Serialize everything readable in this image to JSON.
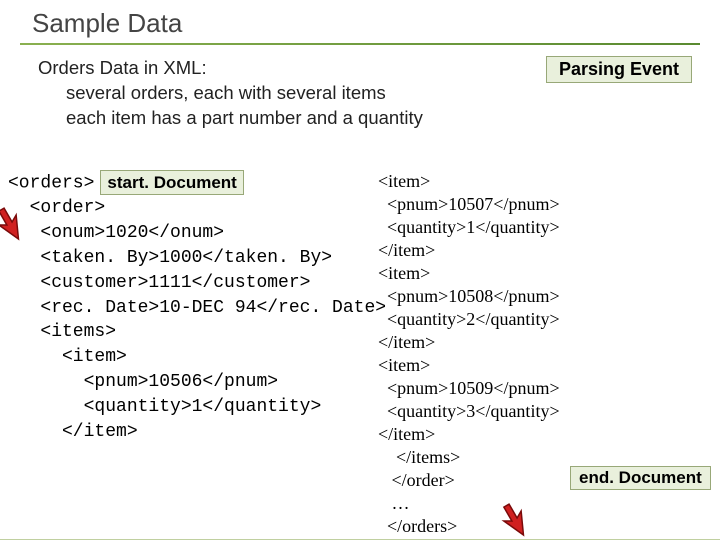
{
  "title": "Sample Data",
  "desc_line1": "Orders Data in XML:",
  "desc_line2": "several orders, each with several items",
  "desc_line3": "each item has a part number and a quantity",
  "parsing_event_label": "Parsing Event",
  "startdoc_label": "start. Document",
  "enddoc_label": "end. Document",
  "code_left": "<orders>\n  <order>\n   <onum>1020</onum>\n   <taken. By>1000</taken. By>\n   <customer>1111</customer>\n   <rec. Date>10-DEC 94</rec. Date>\n   <items>\n     <item>\n       <pnum>10506</pnum>\n       <quantity>1</quantity>\n     </item>",
  "code_right": "<item>\n  <pnum>10507</pnum>\n  <quantity>1</quantity>\n</item>\n<item>\n  <pnum>10508</pnum>\n  <quantity>2</quantity>\n</item>\n<item>\n  <pnum>10509</pnum>\n  <quantity>3</quantity>\n</item>\n    </items>\n   </order>\n   …\n  </orders>"
}
